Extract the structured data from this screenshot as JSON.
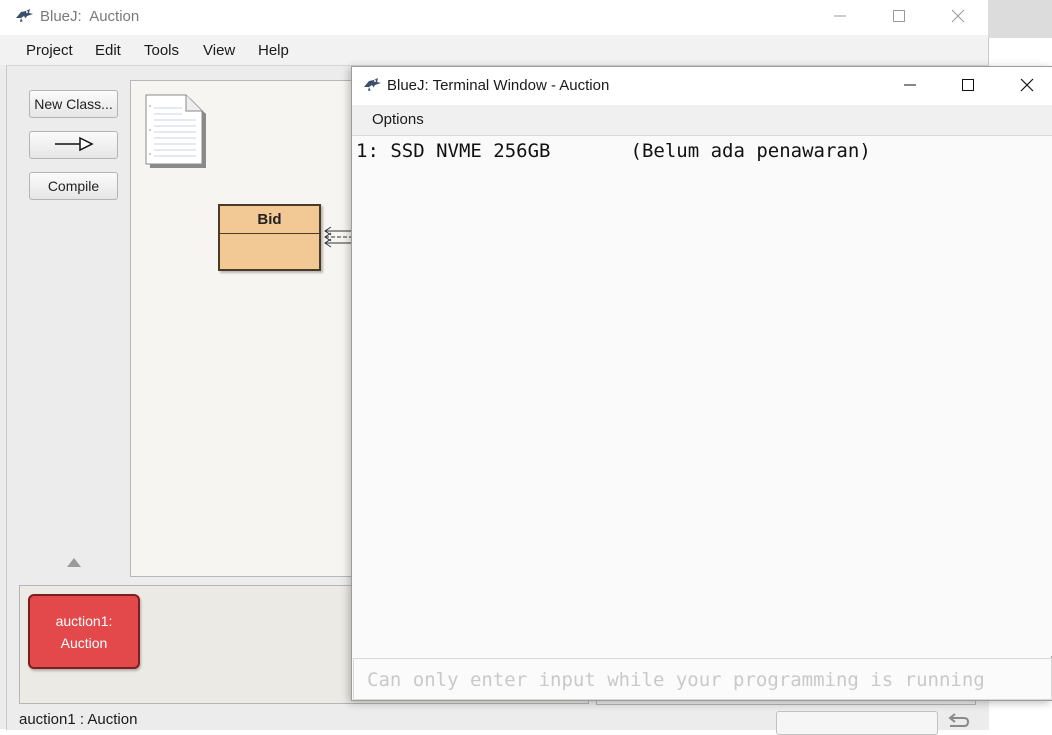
{
  "main_window": {
    "title": "BlueJ:  Auction",
    "menu": [
      "Project",
      "Edit",
      "Tools",
      "View",
      "Help"
    ]
  },
  "toolbar": {
    "new_class_label": "New Class...",
    "compile_label": "Compile"
  },
  "diagram": {
    "classes": [
      {
        "name": "Bid",
        "color": "#f2c994"
      }
    ]
  },
  "object_bench": {
    "objects": [
      {
        "label_line1": "auction1:",
        "label_line2": "Auction",
        "color": "#e3484b"
      }
    ]
  },
  "status_bar": {
    "text": "auction1 : Auction"
  },
  "terminal": {
    "title": "BlueJ: Terminal Window - Auction",
    "menu": [
      "Options"
    ],
    "output_lines": [
      "1: SSD NVME 256GB       (Belum ada penawaran)"
    ],
    "input_placeholder": "Can only enter input while your programming is running"
  },
  "icons": {
    "app": "bluej-bird-icon",
    "minimize": "minimize-icon",
    "maximize": "maximize-icon",
    "close": "close-icon",
    "inheritance_arrow": "inheritance-arrow-icon",
    "readme": "readme-document-icon",
    "scroll_up": "triangle-up-icon",
    "reset": "return-arrow-icon"
  },
  "colors": {
    "class_fill": "#f2c994",
    "object_fill": "#e3484b"
  }
}
